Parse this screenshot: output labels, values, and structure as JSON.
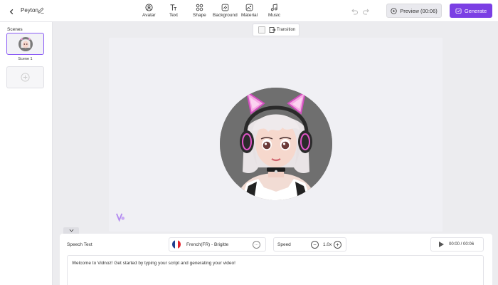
{
  "header": {
    "project_name": "Peyton",
    "tools": [
      {
        "label": "Avatar",
        "icon": "avatar-icon"
      },
      {
        "label": "Text",
        "icon": "text-icon"
      },
      {
        "label": "Shape",
        "icon": "shape-icon"
      },
      {
        "label": "Background",
        "icon": "background-icon"
      },
      {
        "label": "Material",
        "icon": "material-icon"
      },
      {
        "label": "Music",
        "icon": "music-icon"
      }
    ],
    "preview_label": "Preview (00:06)",
    "generate_label": "Generate",
    "accent_color": "#7b3fe4"
  },
  "scenes": {
    "title": "Scenes",
    "items": [
      {
        "label": "Scene 1"
      }
    ]
  },
  "canvas": {
    "transition_label": "Transition"
  },
  "bottom": {
    "speech_label": "Speech Text",
    "voice": {
      "name": "French(FR) - Brigitte",
      "flag_colors": [
        "#1f3f8f",
        "#ffffff",
        "#e3222c"
      ]
    },
    "speed": {
      "label": "Speed",
      "value": "1.0x"
    },
    "player": {
      "time": "00:00 / 00:06"
    },
    "script_text": "Welcome to Vidnoz! Get started by typing your script and generating your video!"
  }
}
